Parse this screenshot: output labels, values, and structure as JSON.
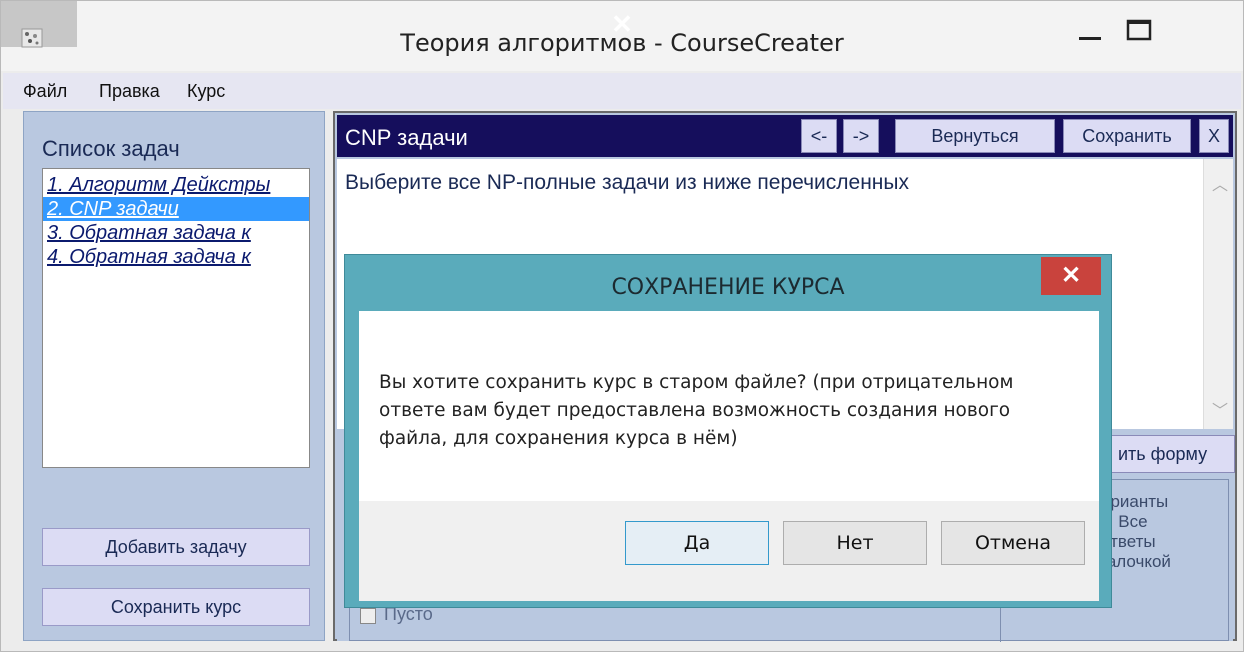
{
  "window": {
    "title": "Теория алгоритмов - CourseCreater",
    "minimize_glyph": "—",
    "close_glyph": "✕"
  },
  "menu": {
    "items": [
      "Файл",
      "Правка",
      "Курс"
    ]
  },
  "left_panel": {
    "title": "Список задач",
    "tasks": [
      "1. Алгоритм Дейкстры",
      "2. CNP задачи",
      "3. Обратная задача к",
      "4. Обратная задача к"
    ],
    "add_button": "Добавить задачу",
    "save_button": "Сохранить курс"
  },
  "right_panel": {
    "title": "CNP задачи",
    "prev_button": "<-",
    "next_button": "->",
    "back_button": "Вернуться",
    "save_button": "Сохранить",
    "close_button": "X",
    "question": "Выберите все NP-полные задачи из ниже перечисленных",
    "form_button": "ить форму",
    "hint_lines": [
      "арианты",
      "з. Все",
      "ответы",
      "галочкой"
    ],
    "empty_option": "Пусто"
  },
  "dialog": {
    "title": "СОХРАНЕНИЕ КУРСА",
    "close_glyph": "✕",
    "message": "Вы хотите сохранить курс в старом файле? (при отрицательном ответе вам будет предоставлена возможность создания нового файла, для сохранения курса в нём)",
    "yes": "Да",
    "no": "Нет",
    "cancel": "Отмена"
  },
  "colors": {
    "dialog_frame": "#5aabbb",
    "dialog_close": "#c9433d",
    "header_bg": "#150e5c",
    "panel_bg": "#b9c8e0",
    "selected": "#3399ff"
  }
}
